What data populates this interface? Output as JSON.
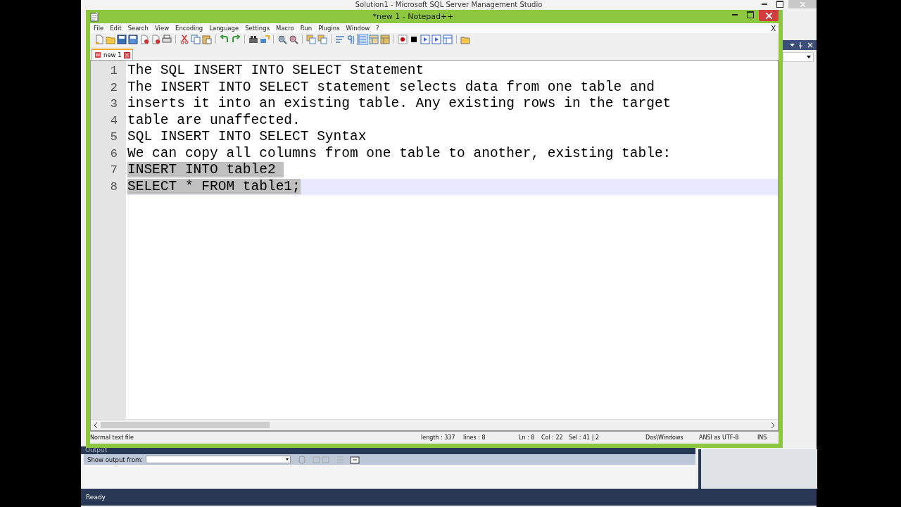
{
  "background_window": {
    "title": "Solution1 - Microsoft SQL Server Management Studio",
    "output": {
      "title": "Output",
      "label": "Show output from:"
    },
    "status": "Ready"
  },
  "window": {
    "title": "*new  1 - Notepad++"
  },
  "menu": [
    "File",
    "Edit",
    "Search",
    "View",
    "Encoding",
    "Language",
    "Settings",
    "Macro",
    "Run",
    "Plugins",
    "Window",
    "?"
  ],
  "menu_close": "X",
  "tabs": [
    {
      "label": "new 1",
      "selected": true,
      "modified": true
    }
  ],
  "lines": [
    {
      "number": "1",
      "text": "The SQL INSERT INTO SELECT Statement",
      "selected": false,
      "current": false
    },
    {
      "number": "2",
      "text": "The INSERT INTO SELECT statement selects data from one table and",
      "selected": false,
      "current": false
    },
    {
      "number": "3",
      "text": "inserts it into an existing table. Any existing rows in the target",
      "selected": false,
      "current": false
    },
    {
      "number": "4",
      "text": "table are unaffected.",
      "selected": false,
      "current": false
    },
    {
      "number": "5",
      "text": "SQL INSERT INTO SELECT Syntax",
      "selected": false,
      "current": false
    },
    {
      "number": "6",
      "text": "We can copy all columns from one table to another, existing table:",
      "selected": false,
      "current": false
    },
    {
      "number": "7",
      "text": "INSERT INTO table2 ",
      "selected": true,
      "current": false
    },
    {
      "number": "8",
      "text": "SELECT * FROM table1;",
      "selected": true,
      "current": true
    }
  ],
  "status_bar": {
    "file_type": "Normal text file",
    "length": "length : 337",
    "lines": "lines : 8",
    "ln": "Ln : 8",
    "col": "Col : 22",
    "sel": "Sel : 41 | 2",
    "eol": "Dos\\Windows",
    "encoding": "ANSI as UTF-8",
    "mode": "INS"
  }
}
